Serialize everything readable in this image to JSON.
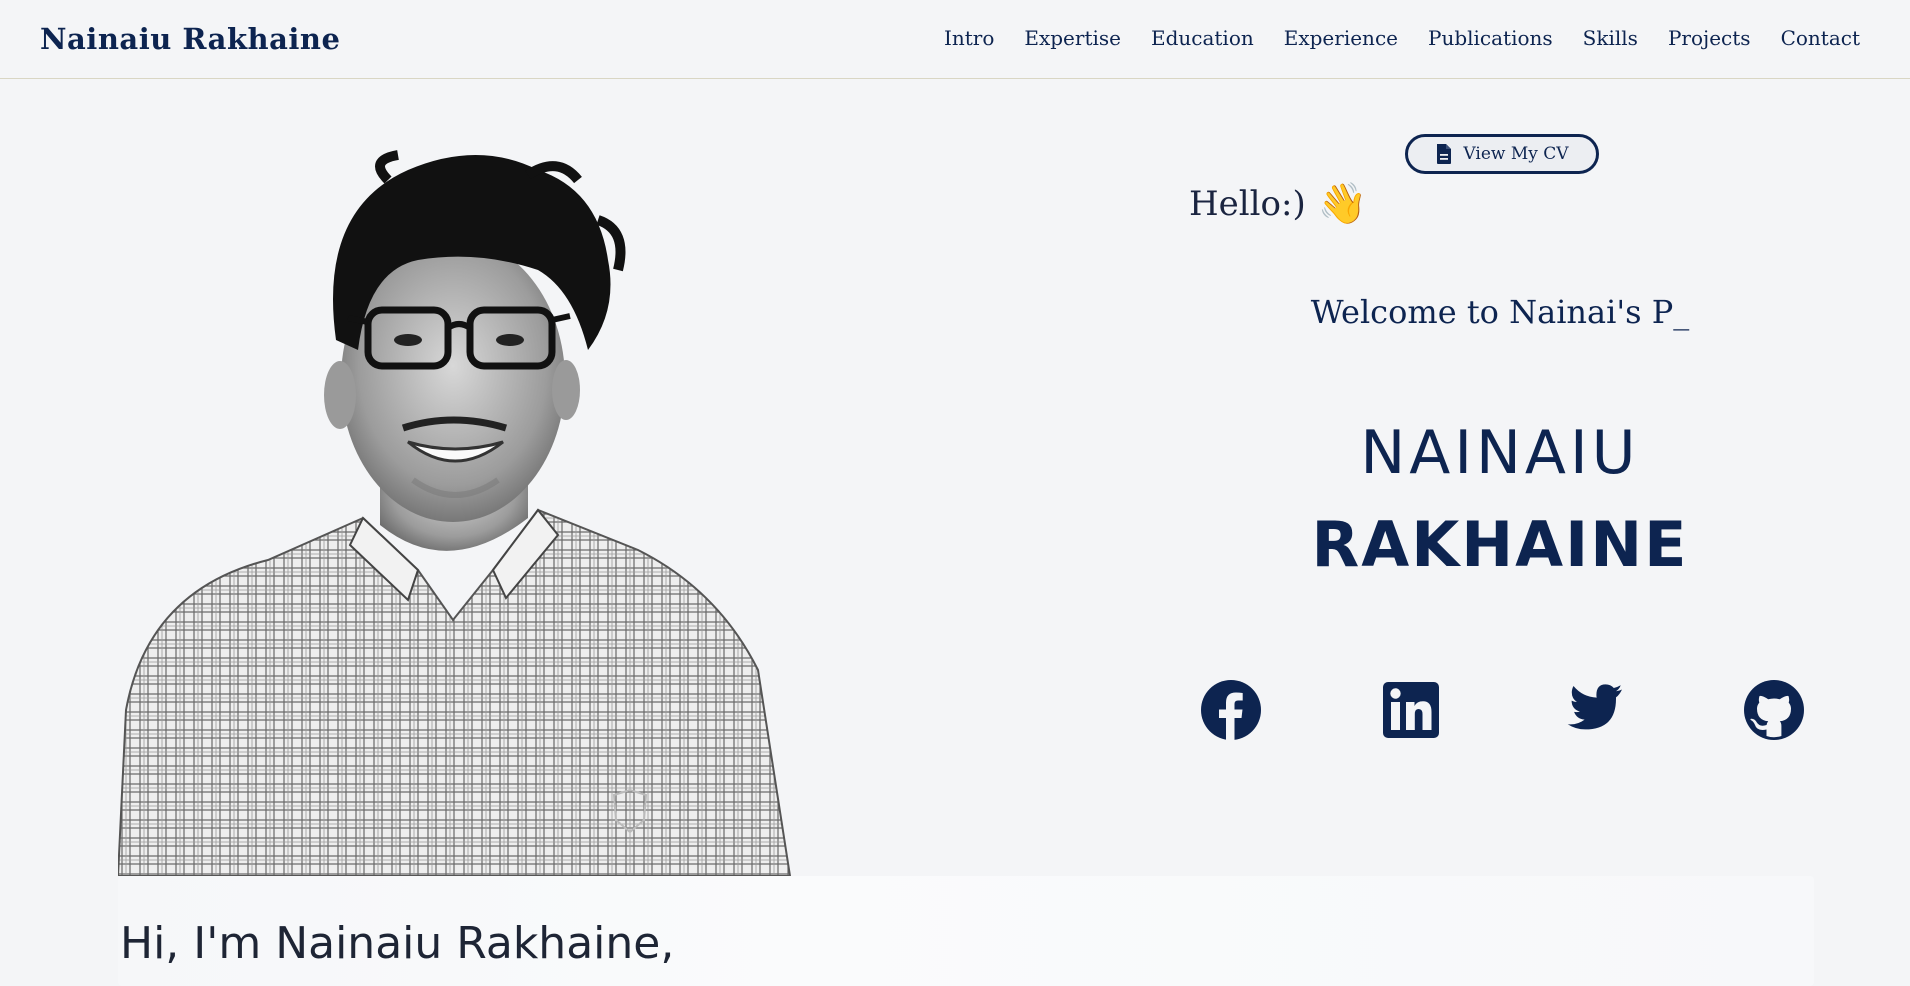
{
  "brand": "Nainaiu Rakhaine",
  "nav": [
    "Intro",
    "Expertise",
    "Education",
    "Experience",
    "Publications",
    "Skills",
    "Projects",
    "Contact"
  ],
  "hero": {
    "cv_button": "View My CV",
    "greeting": "Hello:)",
    "greeting_emoji": "👋",
    "welcome": "Welcome to Nainai's P_",
    "first_name": "NAINAIU",
    "last_name": "RAKHAINE",
    "social_icons": [
      "facebook-icon",
      "linkedin-icon",
      "twitter-icon",
      "github-icon"
    ]
  },
  "about": {
    "heading": "Hi, I'm Nainaiu Rakhaine,"
  },
  "colors": {
    "primary": "#0d2450",
    "background": "#f4f5f7"
  }
}
